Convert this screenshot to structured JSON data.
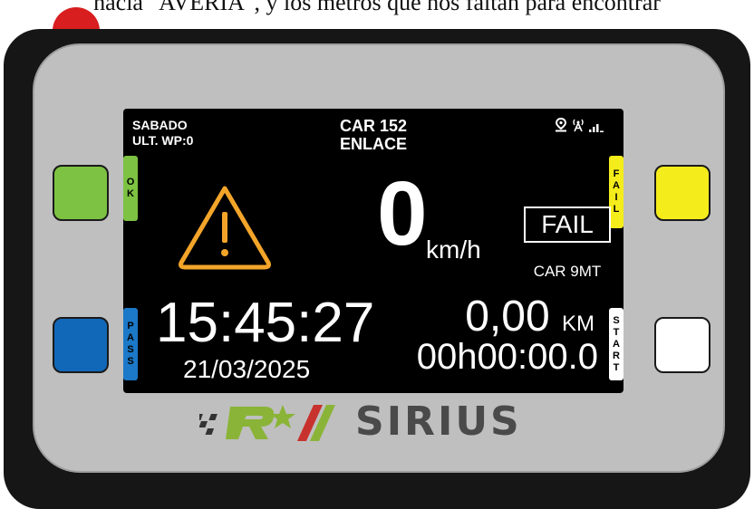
{
  "caption": "hacia \"AVERIA\", y los metros que nos faltan para encontrar",
  "screen": {
    "day": "SABADO",
    "last_wp": "ULT. WP:0",
    "car_title": "CAR 152",
    "mode": "ENLACE",
    "speed": "0",
    "speed_unit": "km/h",
    "fail_status": "FAIL",
    "car_code": "CAR 9MT",
    "clock": "15:45:27",
    "date": "21/03/2025",
    "distance_value": "0,00",
    "distance_unit": "KM",
    "elapsed": "00h00:00.0"
  },
  "tabs": {
    "ok": [
      "O",
      "K"
    ],
    "pass": [
      "P",
      "A",
      "S",
      "S"
    ],
    "fail": [
      "F",
      "A",
      "I",
      "L"
    ],
    "start": [
      "S",
      "T",
      "A",
      "R",
      "T"
    ]
  },
  "brand": "SIRIUS",
  "colors": {
    "ok": "#7dc242",
    "pass": "#1c78c8",
    "fail": "#f5ec1c",
    "start": "#ffffff",
    "warning": "#f3a52a",
    "logo_green": "#8ab437",
    "logo_red": "#c8322e"
  },
  "icons": [
    "location-icon",
    "antenna-icon",
    "signal-icon",
    "warning-icon"
  ]
}
